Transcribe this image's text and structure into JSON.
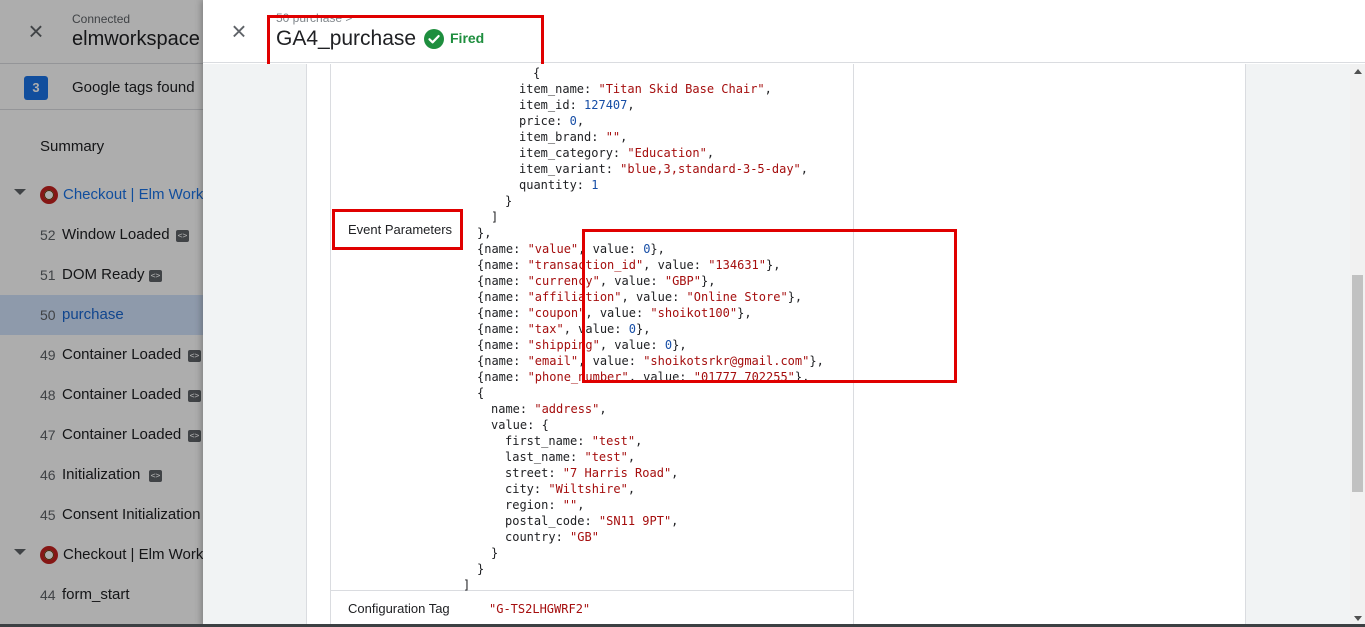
{
  "background": {
    "connected_label": "Connected",
    "workspace_name": "elmworkspace",
    "tags_count": "3",
    "tags_label": "Google tags found",
    "summary_label": "Summary",
    "groups": [
      {
        "label": "Checkout | Elm Work"
      },
      {
        "label": "Checkout | Elm Work"
      }
    ],
    "events": [
      {
        "num": "52",
        "label": "Window Loaded"
      },
      {
        "num": "51",
        "label": "DOM Ready"
      },
      {
        "num": "50",
        "label": "purchase"
      },
      {
        "num": "49",
        "label": "Container Loaded"
      },
      {
        "num": "48",
        "label": "Container Loaded"
      },
      {
        "num": "47",
        "label": "Container Loaded"
      },
      {
        "num": "46",
        "label": "Initialization"
      },
      {
        "num": "45",
        "label": "Consent Initialization"
      },
      {
        "num": "44",
        "label": "form_start"
      }
    ],
    "code_badge": "<>"
  },
  "drawer": {
    "breadcrumb": "50 purchase >",
    "tag_title": "GA4_purchase",
    "status": "Fired",
    "status_color": "#1e8e3e",
    "highlight_color": "#e00000",
    "event_params_label": "Event Parameters",
    "config_label": "Configuration Tag",
    "config_value": "\"G-TS2LHGWRF2\"",
    "code_lines": [
      "{",
      "item_name: \"Titan Skid Base Chair\",",
      "item_id: 127407,",
      "price: 0,",
      "item_brand: \"\",",
      "item_category: \"Education\",",
      "item_variant: \"blue,3,standard-3-5-day\",",
      "quantity: 1",
      "}",
      "]",
      "},",
      "{name: \"value\", value: 0},",
      "{name: \"transaction_id\", value: \"134631\"},",
      "{name: \"currency\", value: \"GBP\"},",
      "{name: \"affiliation\", value: \"Online Store\"},",
      "{name: \"coupon\", value: \"shoikot100\"},",
      "{name: \"tax\", value: 0},",
      "{name: \"shipping\", value: 0},",
      "{name: \"email\", value: \"shoikotsrkr@gmail.com\"},",
      "{name: \"phone_number\", value: \"01777 702255\"},",
      "{",
      "name: \"address\",",
      "value: {",
      "first_name: \"test\",",
      "last_name: \"test\",",
      "street: \"7 Harris Road\",",
      "city: \"Wiltshire\",",
      "region: \"\",",
      "postal_code: \"SN11 9PT\",",
      "country: \"GB\"",
      "}",
      "}",
      "]"
    ]
  }
}
